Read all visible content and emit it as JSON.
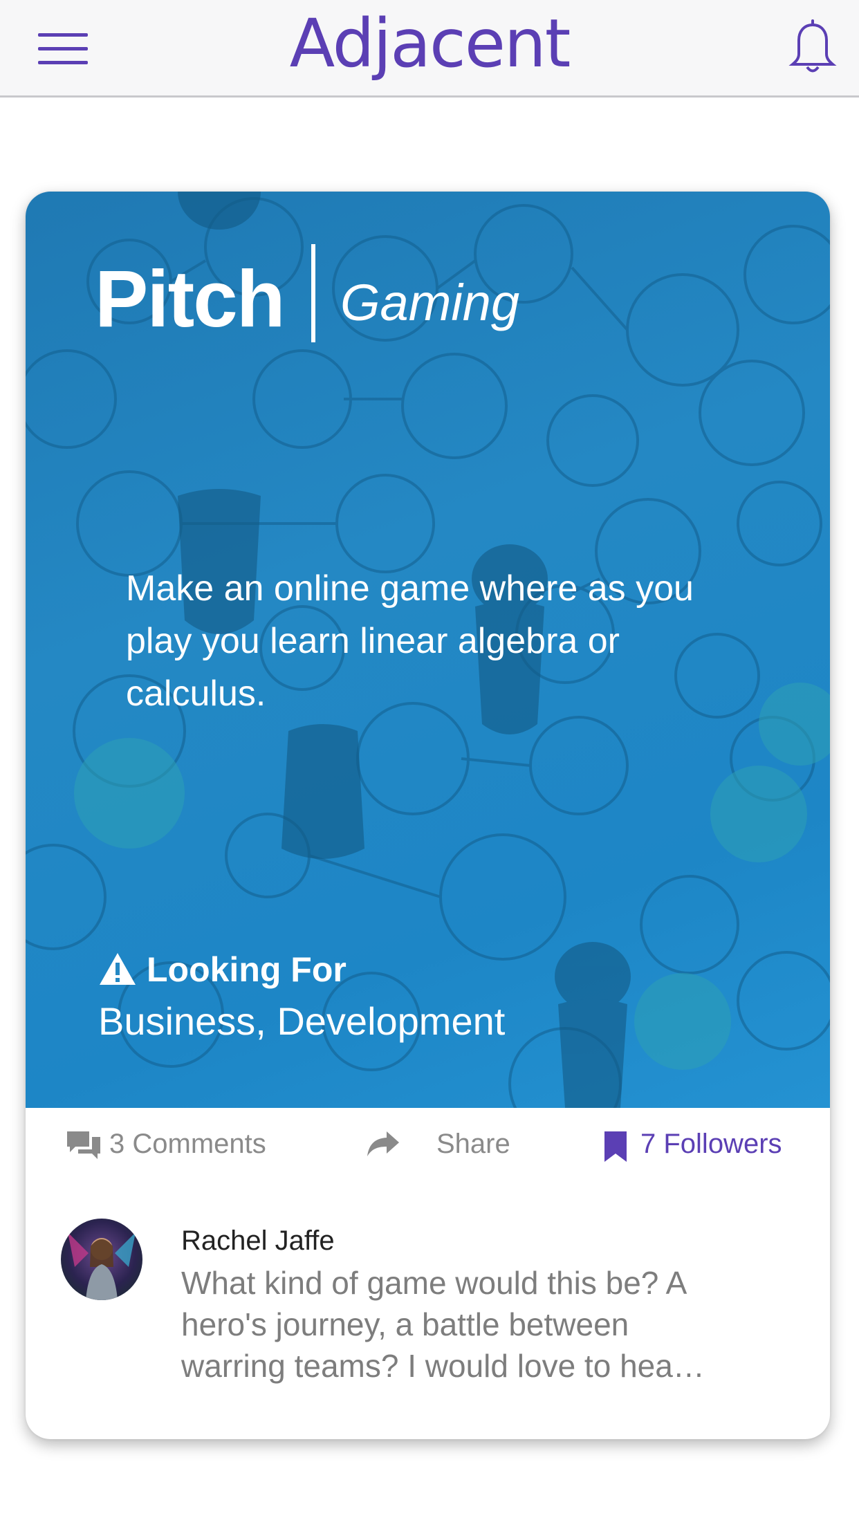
{
  "header": {
    "app_name": "Adjacent",
    "menu_icon": "hamburger-menu-icon",
    "notification_icon": "bell-icon",
    "accent_color": "#5b3fb4"
  },
  "card": {
    "type_label": "Pitch",
    "category": "Gaming",
    "pitch_text": "Make an online game where as you play you learn linear algebra or calculus.",
    "looking_for_label": "Looking For",
    "looking_for_value": "Business, Development",
    "hero_color": "#2488c4"
  },
  "actions": {
    "comments_label": "3 Comments",
    "share_label": "Share",
    "followers_label": "7 Followers"
  },
  "comment": {
    "author": "Rachel Jaffe",
    "text": "What kind of game would this be? A\nhero's journey, a battle between\nwarring teams? I would love to hea…"
  }
}
